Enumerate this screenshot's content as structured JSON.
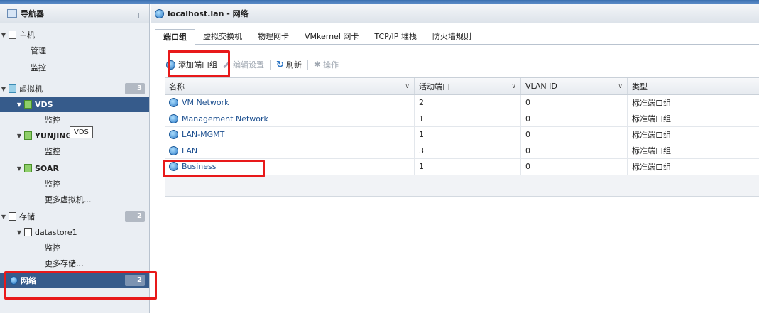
{
  "navigator": {
    "title": "导航器",
    "items": [
      {
        "label": "主机"
      },
      {
        "label": "管理"
      },
      {
        "label": "监控"
      },
      {
        "label": "虚拟机",
        "count": "3"
      },
      {
        "label": "VDS"
      },
      {
        "label": "监控"
      },
      {
        "label": "YUNJING"
      },
      {
        "label": "监控"
      },
      {
        "label": "SOAR"
      },
      {
        "label": "监控"
      },
      {
        "label": "更多虚拟机..."
      },
      {
        "label": "存储",
        "count": "2"
      },
      {
        "label": "datastore1"
      },
      {
        "label": "监控"
      },
      {
        "label": "更多存储..."
      },
      {
        "label": "网络",
        "count": "2"
      }
    ],
    "tooltip": "VDS"
  },
  "main": {
    "title": "localhost.lan - 网络",
    "tabs": [
      "端口组",
      "虚拟交换机",
      "物理网卡",
      "VMkernel 网卡",
      "TCP/IP 堆栈",
      "防火墙规则"
    ],
    "toolbar": {
      "add": "添加端口组",
      "edit": "编辑设置",
      "refresh": "刷新",
      "actions": "操作"
    },
    "columns": [
      "名称",
      "活动端口",
      "VLAN ID",
      "类型"
    ],
    "rows": [
      {
        "name": "VM Network",
        "ports": "2",
        "vlan": "0",
        "type": "标准端口组"
      },
      {
        "name": "Management Network",
        "ports": "1",
        "vlan": "0",
        "type": "标准端口组"
      },
      {
        "name": "LAN-MGMT",
        "ports": "1",
        "vlan": "0",
        "type": "标准端口组"
      },
      {
        "name": "LAN",
        "ports": "3",
        "vlan": "0",
        "type": "标准端口组"
      },
      {
        "name": "Business",
        "ports": "1",
        "vlan": "0",
        "type": "标准端口组"
      }
    ]
  },
  "colors": {
    "accent": "#365b8b",
    "annotation_red": "#e8191a",
    "link": "#1c4f8f"
  }
}
